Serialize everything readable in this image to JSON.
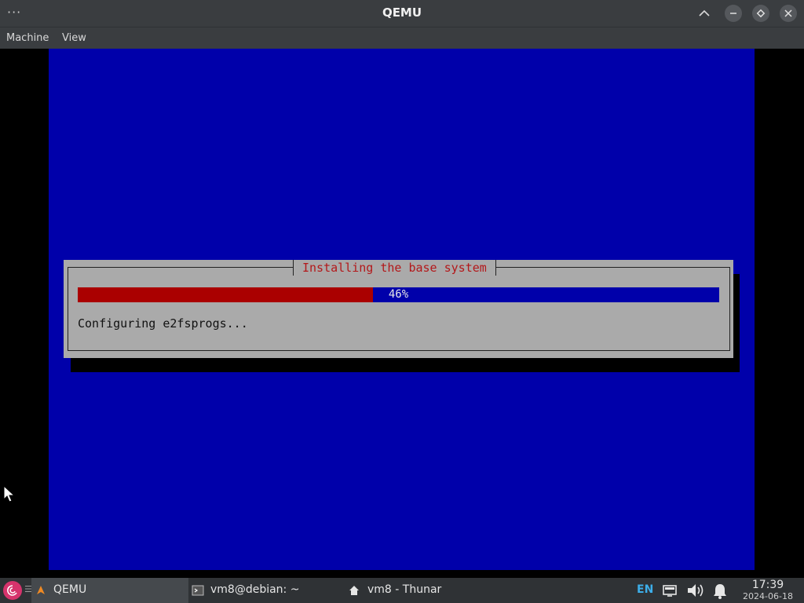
{
  "window": {
    "title": "QEMU",
    "overflow_glyph": "···",
    "icons": [
      "keep-above-icon",
      "minimize-icon",
      "maximize-icon",
      "close-icon"
    ]
  },
  "menu": {
    "items": [
      "Machine",
      "View"
    ]
  },
  "installer": {
    "dialog_title": "Installing the base system",
    "progress_percent": 46,
    "progress_label": "46%",
    "status": "Configuring e2fsprogs..."
  },
  "taskbar": {
    "menu_glyph": "☰",
    "tasks": [
      {
        "label": "QEMU",
        "icon": "qemu-icon",
        "active": true
      },
      {
        "label": "vm8@debian: ~",
        "icon": "terminal-icon",
        "active": false
      },
      {
        "label": "vm8 - Thunar",
        "icon": "home-folder-icon",
        "active": false
      }
    ],
    "keyboard_layout": "EN",
    "tray_icons": [
      "display-icon",
      "volume-icon",
      "notification-bell-icon"
    ],
    "clock": {
      "time": "17:39",
      "date": "2024-06-18"
    }
  },
  "colors": {
    "screen_bg": "#0000aa",
    "dialog_bg": "#aaaaaa",
    "dialog_title": "#b3181a",
    "progress_fill": "#aa0000",
    "accent": "#3daee9"
  }
}
